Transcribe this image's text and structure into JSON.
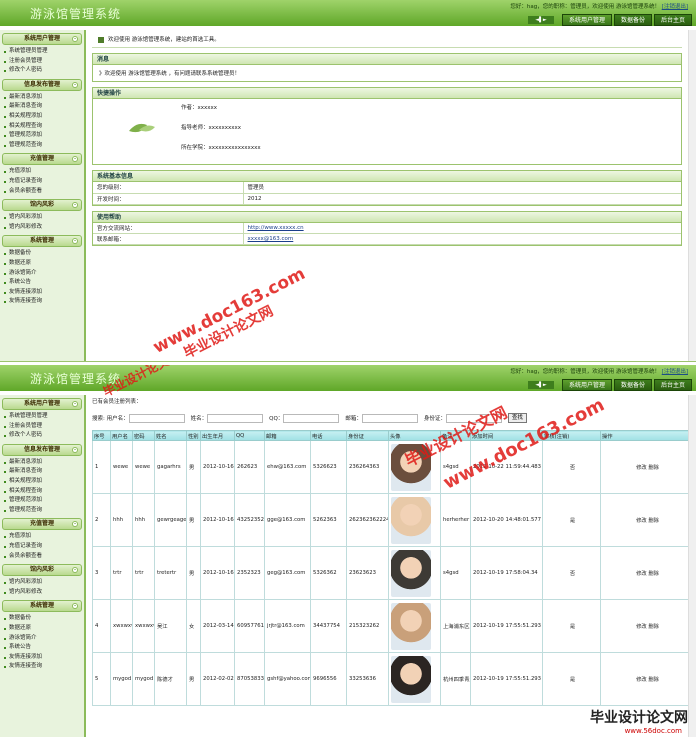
{
  "app": {
    "title": "游泳馆管理系统",
    "top_info": "您好：hag，您的职称：管理员，欢迎使用 游泳馆管理系统！",
    "logout": "[注销退出]",
    "nav_arrows": "◄▌►",
    "tabs": [
      "系统用户管理",
      "数据备份",
      "后台主页"
    ]
  },
  "sidebar": [
    {
      "title": "系统用户管理",
      "items": [
        "系统管理员管理",
        "注册会员管理",
        "修改个人密码"
      ]
    },
    {
      "title": "信息发布管理",
      "items": [
        "最新消息添加",
        "最新消息查询",
        "相关规程添加",
        "相关规程查询",
        "管理规范添加",
        "管理规范查询"
      ]
    },
    {
      "title": "充值管理",
      "items": [
        "充值添加",
        "充值记录查询",
        "会员余额查看"
      ]
    },
    {
      "title": "馆内风彩",
      "items": [
        "馆内风彩添加",
        "馆内风彩修改"
      ]
    },
    {
      "title": "系统管理",
      "items": [
        "数据备份",
        "数据还原",
        "游泳馆简介",
        "系统公告",
        "友情连接添加",
        "友情连接查询"
      ]
    }
  ],
  "home": {
    "welcome": "欢迎使用 游泳馆管理系统，建站的首选工具。",
    "news_title": "消息",
    "news_text": "》欢迎使用 游泳馆管理系统 ，有问题请联系系统管理员！",
    "quick_title": "快捷操作",
    "author": "作者：xxxxxx",
    "teacher": "指导老师：xxxxxxxxxx",
    "school": "所在学院：xxxxxxxxxxxxxxxx",
    "sysinfo_title": "系统基本信息",
    "sysinfo": [
      {
        "k": "您的级别：",
        "v": "管理员"
      },
      {
        "k": "开发时间：",
        "v": "2012"
      }
    ],
    "help_title": "使用帮助",
    "help": [
      {
        "k": "官方交流网站：",
        "v": "http://www.xxxxx.cn"
      },
      {
        "k": "联系邮箱：",
        "v": "xxxxx@163.com"
      }
    ]
  },
  "members": {
    "list_label": "已有会员注册列表：",
    "search": {
      "prefix": "搜索:",
      "labels": [
        "用户名：",
        "姓名：",
        "QQ：",
        "邮箱：",
        "身份证："
      ],
      "button": "查找"
    },
    "columns": [
      "序号",
      "用户名",
      "密码",
      "姓名",
      "性别",
      "出生年月",
      "QQ",
      "邮箱",
      "电话",
      "身份证",
      "头像",
      "备注",
      "添加时间",
      "审核(注销)",
      "操作"
    ],
    "rows": [
      {
        "no": "1",
        "user": "wewe",
        "pwd": "wewe",
        "name": "gagarhrs",
        "sex": "男",
        "birth": "2012-10-16",
        "qq": "262623",
        "email": "ehw@163.com",
        "tel": "5326623",
        "id": "236264363",
        "remark": "hshs",
        "time": "2012-10-22 11:59:44.483",
        "audit": "否",
        "op": "修改 删除"
      },
      {
        "no": "2",
        "user": "hhh",
        "pwd": "hhh",
        "name": "gewrgeage",
        "sex": "男",
        "birth": "2012-10-16",
        "qq": "43252352",
        "email": "gge@163.com",
        "tel": "5262363",
        "id": "2623623622243",
        "remark": "herherher",
        "time": "2012-10-20 14:48:01.577",
        "audit": "是",
        "op": "修改 删除"
      },
      {
        "no": "3",
        "user": "trtr",
        "pwd": "trtr",
        "name": "tretertr",
        "sex": "男",
        "birth": "2012-10-16",
        "qq": "2352323",
        "email": "geg@163.com",
        "tel": "5326362",
        "id": "23623623",
        "remark": "hsdhsd",
        "time": "2012-10-19 17:58:04.34",
        "audit": "否",
        "op": "修改 删除"
      },
      {
        "no": "4",
        "user": "xwxwxw",
        "pwd": "xwxwxw",
        "name": "吴江",
        "sex": "女",
        "birth": "2012-03-14",
        "qq": "609577616",
        "email": "jrjtr@163.com",
        "tel": "34437754",
        "id": "215323262",
        "remark": "gfdhth",
        "time": "2012-10-19 17:55:51.293",
        "audit": "是",
        "op": "修改 删除"
      },
      {
        "no": "5",
        "user": "mygod",
        "pwd": "mygod",
        "name": "陈德才",
        "sex": "男",
        "birth": "2012-02-02",
        "qq": "870538338",
        "email": "gshf@yahoo.com",
        "tel": "9696556",
        "id": "33253636",
        "remark": "hdhff4",
        "time": "2012-10-19 17:55:51.293",
        "audit": "是",
        "op": "修改 删除"
      }
    ],
    "row_extra": [
      "s4gsd",
      "",
      "s4gsd",
      "上海浦东区22号",
      "杭州四季青广场5号"
    ]
  },
  "watermarks": [
    "www.doc163.com",
    "毕业设计论文网"
  ],
  "logo": {
    "text": "毕业设计论文网",
    "url": "www.56doc.com"
  },
  "colors": {
    "accent": "#5fa728",
    "tab": "#2a5d10",
    "table_header": "#a8e4e8"
  }
}
